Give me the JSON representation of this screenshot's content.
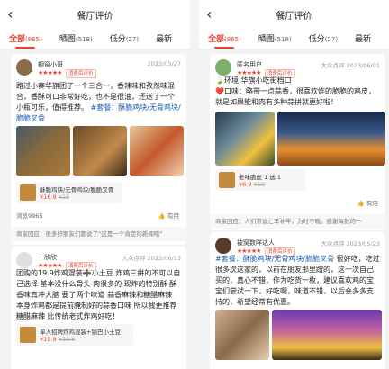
{
  "left": {
    "title": "餐厅评价",
    "tabs": [
      {
        "label": "全部",
        "count": "(865)"
      },
      {
        "label": "晒图",
        "count": "(518)"
      },
      {
        "label": "低分",
        "count": "(27)"
      },
      {
        "label": "最新",
        "count": ""
      }
    ],
    "reviews": [
      {
        "user": "橱窗小哥",
        "stars": "★★★★★",
        "badge": "消费后评价",
        "date": "2023/05/27",
        "text": "路过小寨华旗团了一个三合一，香辣味和孜然味混合，香酥可口非常好吃，也不是很油，还送了一个小瓶可乐，值得推荐。",
        "tag": "#套餐：酥脆鸡块/无骨鸡块/脆脆叉骨",
        "product": {
          "name": "酥脆鸡块/无骨鸡块/脆脆叉骨",
          "price": "¥16.9",
          "old_price": "¥28"
        },
        "views": "浏览9965",
        "useful": "有用",
        "reply": "商家回应：很多好朋友们都说了“这是一个肯定的新闻哦”"
      },
      {
        "user": "一欣欣",
        "stars": "★★★★★",
        "badge": "消费后评价",
        "source": "大众点评",
        "date": "2023/06/13",
        "text": "团购的19.9炸鸡混装➕小土豆 炸鸡三拼的不可以自己选择 基本没什么骨头 肉很多的 现炸的特别酥 酥香味真冲大脑 要了两个味道 蒜香麻辣和糖醋麻辣 本身炸鸡都是提前腌制好的蒜香口味 所以我更推荐糖醋麻辣 比传统老式炸鸡好吃！",
        "product": {
          "name": "单人招牌炸鸡混装+锅巴小土豆",
          "price": "¥19.9",
          "old_price": "¥29.8"
        }
      }
    ]
  },
  "right": {
    "title": "餐厅评价",
    "tabs": [
      {
        "label": "全部",
        "count": "(865)"
      },
      {
        "label": "晒图",
        "count": "(518)"
      },
      {
        "label": "低分",
        "count": "(27)"
      },
      {
        "label": "最新",
        "count": ""
      }
    ],
    "reviews": [
      {
        "user": "匿名用户",
        "stars": "★★★★★",
        "badge": "消费后评价",
        "source": "大众点评",
        "date": "2023/06/01",
        "location": "🍃环境:华旗小吃街档口",
        "text": "❤️口味：略带一点蒜香，很喜欢炸的脆脆的鸡皮，就是如果能和肉有多种蒜拼就更好啦！",
        "product": {
          "name": "老味脆皮 1 选 1",
          "price": "¥6.9",
          "old_price": "¥10"
        },
        "useful": "有用",
        "reply": "商家回应：人们常说亡羊补牢，为时不晚。感谢每数的一"
      },
      {
        "user": "被窝数咩达人",
        "stars": "★★★★★",
        "badge": "消费后评价",
        "source": "大众点评",
        "date": "2023/05/23",
        "tag": "#套餐：酥脆鸡块/无骨鸡块/脆脆叉骨",
        "text": " 很好吃，吃过很多次这家的，以前在朋友那里蹭的，这一次自己买的，真心不错，作为吃货一枚，建议喜欢鸡的宝宝们尝试一下，好吃啊，味道不错，以后会多多支持的，希望经常有优惠。"
      }
    ]
  }
}
